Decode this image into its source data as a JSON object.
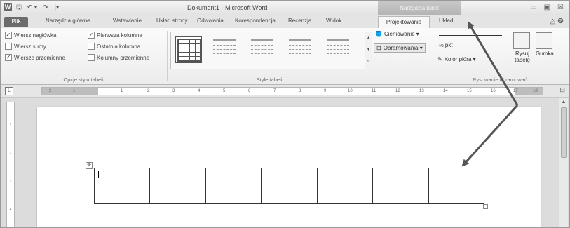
{
  "window": {
    "title": "Dokument1 - Microsoft Word",
    "context_tab_group": "Narzędzia tabel",
    "controls": [
      "▭",
      "▣",
      "☒"
    ]
  },
  "quick_access": [
    "W",
    "🖫",
    "↶ ▾",
    "↷",
    "|▾"
  ],
  "tabs": {
    "file": "Plik",
    "items": [
      "Narzędzia główne",
      "Wstawianie",
      "Układ strony",
      "Odwołania",
      "Korespondencja",
      "Recenzja",
      "Widok"
    ],
    "active": "Projektowanie",
    "after_active": "Układ",
    "help": "◬ ❷"
  },
  "ribbon": {
    "table_style_options": {
      "group_label": "Opcje stylu tabeli",
      "checkboxes": [
        {
          "label": "Wiersz nagłówka",
          "checked": true
        },
        {
          "label": "Pierwsza kolumna",
          "checked": true
        },
        {
          "label": "Wiersz sumy",
          "checked": false
        },
        {
          "label": "Ostatnia kolumna",
          "checked": false
        },
        {
          "label": "Wiersze przemienne",
          "checked": true
        },
        {
          "label": "Kolumny przemienne",
          "checked": false
        }
      ]
    },
    "table_styles": {
      "group_label": "Style tabeli",
      "shading": "Cieniowanie ▾",
      "borders": "Obramowania ▾"
    },
    "draw_borders": {
      "group_label": "Rysowanie obramowań",
      "pen_weight": "½ pkt",
      "pen_color": "Kolor pióra ▾",
      "draw_table": "Rysuj tabelę",
      "eraser": "Gumka"
    }
  },
  "ruler": {
    "corner": "L",
    "ticks": [
      "2",
      "1",
      "1",
      "2",
      "3",
      "4",
      "5",
      "6",
      "7",
      "8",
      "9",
      "10",
      "11",
      "12",
      "13",
      "14",
      "15",
      "16",
      "17",
      "18"
    ]
  },
  "document": {
    "table_rows": 3,
    "table_cols": 7,
    "move_handle": "✥"
  },
  "vruler_ticks": [
    "1",
    "2",
    "3",
    "4"
  ]
}
